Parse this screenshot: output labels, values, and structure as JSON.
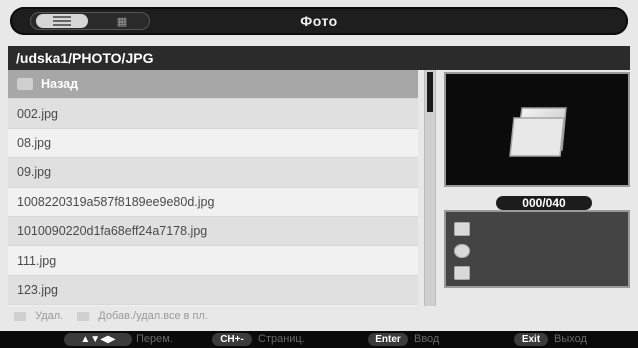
{
  "title": "Фото",
  "view_toggle": {
    "list_icon": "list-view-icon",
    "grid_icon": "grid-view-icon"
  },
  "path": "/udska1/PHOTO/JPG",
  "back_row": {
    "label": "Назад",
    "icon": "back-folder-icon"
  },
  "files": [
    "002.jpg",
    "08.jpg",
    "09.jpg",
    "1008220319a587f8189ee9e80d.jpg",
    "1010090220d1fa68eff24a7178.jpg",
    "111.jpg",
    "123.jpg"
  ],
  "preview": {
    "icon": "folder-icon"
  },
  "counter": "000/040",
  "info_icons": [
    "calendar-icon",
    "camera-icon",
    "resolution-icon"
  ],
  "hints": [
    {
      "label": "Удал."
    },
    {
      "label": "Добав./удал.все в пл."
    }
  ],
  "footer": [
    {
      "key": "▲▼◀▶",
      "label": "Перем."
    },
    {
      "key": "CH+-",
      "label": "Страниц."
    },
    {
      "key": "Enter",
      "label": "Ввод"
    },
    {
      "key": "Exit",
      "label": "Выход"
    }
  ],
  "colors": {
    "header_bg": "#1e1e1e",
    "path_bg": "#2b2b2b",
    "selected_row": "#a7a7a7"
  }
}
